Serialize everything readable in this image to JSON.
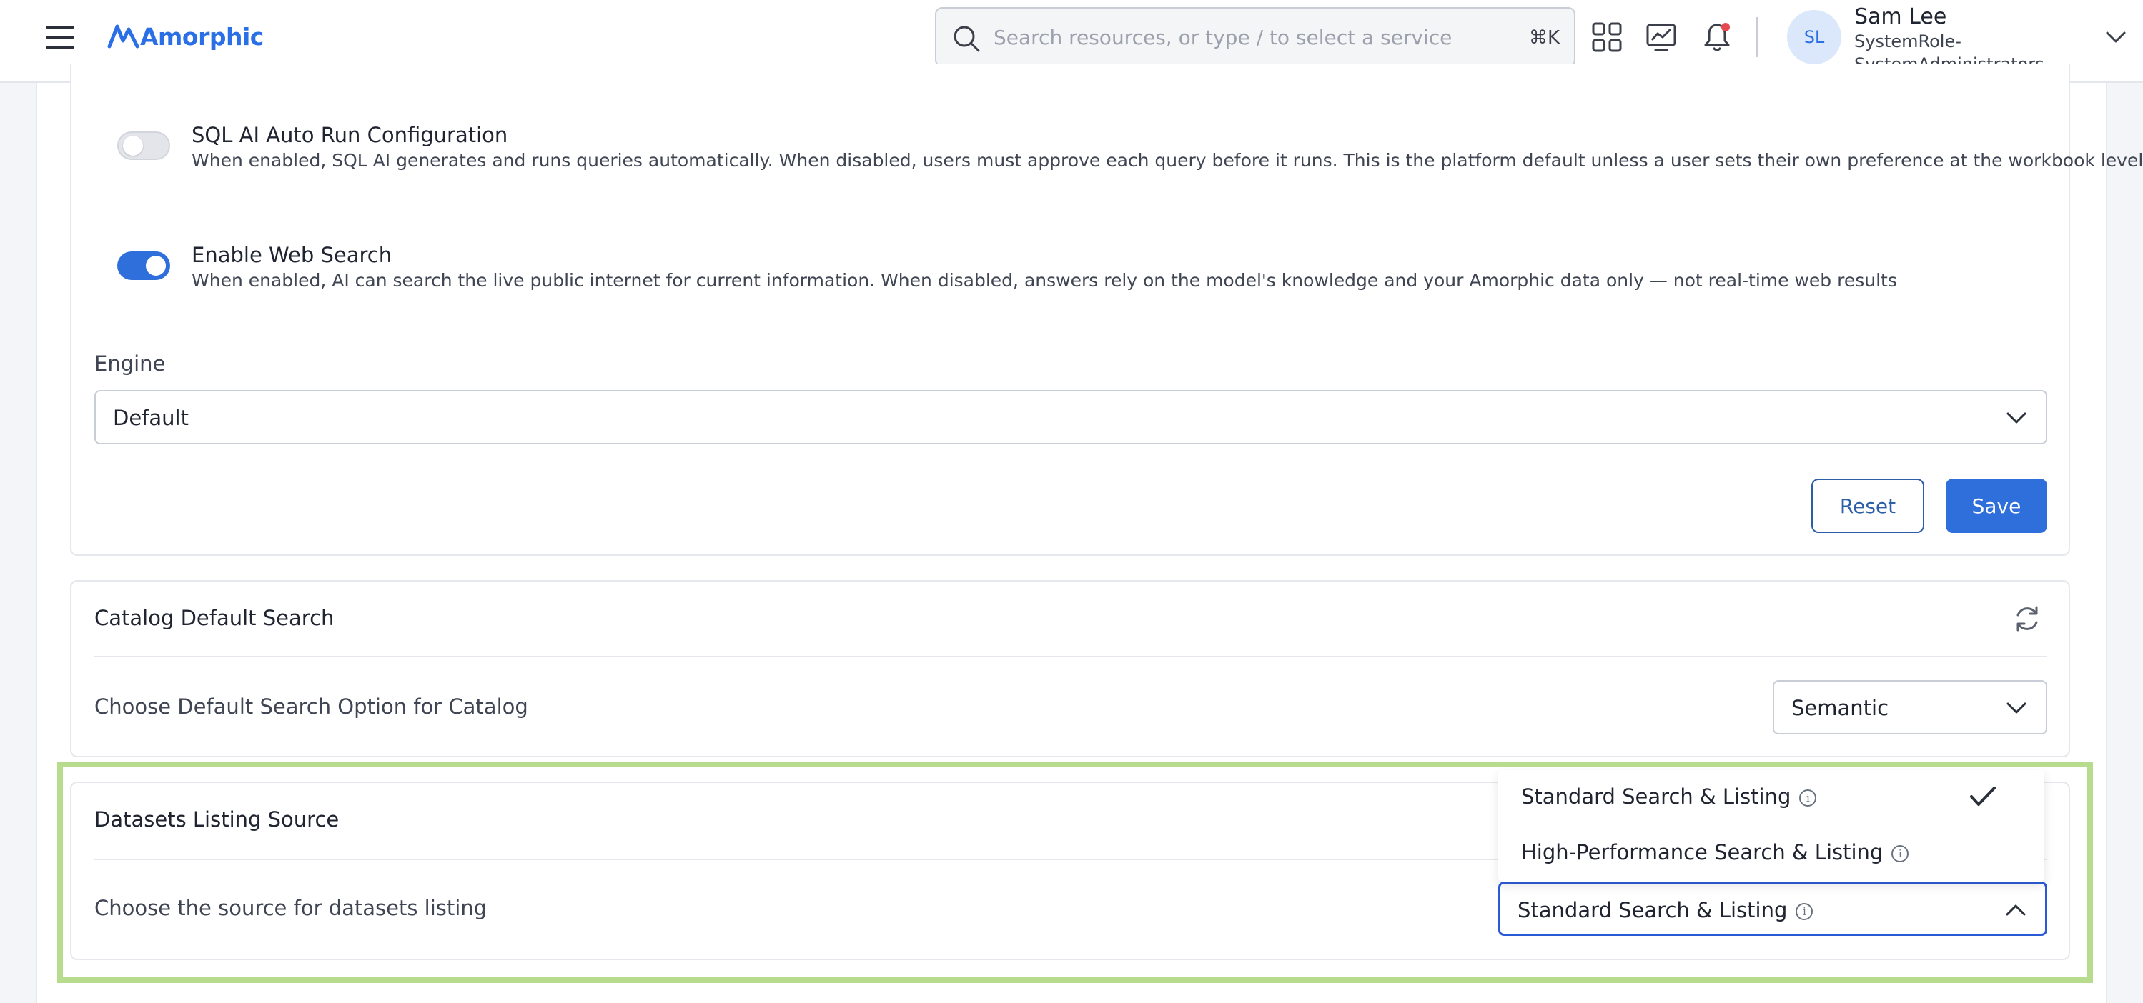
{
  "header": {
    "logo_text": "Amorphic",
    "search_placeholder": "Search resources, or type / to select a service",
    "search_shortcut": "⌘K",
    "user": {
      "initials": "SL",
      "name": "Sam Lee",
      "role": "SystemRole-SystemAdministrators"
    },
    "icons": [
      "menu-icon",
      "search-icon",
      "apps-grid-icon",
      "monitoring-chart-icon",
      "notification-bell-icon",
      "chevron-down-icon"
    ],
    "notification_dot_color": "#e5484d"
  },
  "ai_settings": {
    "sql_auto_run": {
      "title": "SQL AI Auto Run Configuration",
      "description": "When enabled, SQL AI generates and runs queries automatically. When disabled, users must approve each query before it runs. This is the platform default unless a user sets their own preference at the workbook level.",
      "enabled": false
    },
    "web_search": {
      "title": "Enable Web Search",
      "description": "When enabled, AI can search the live public internet for current information. When disabled, answers rely on the model's knowledge and your Amorphic data only — not real-time web results",
      "enabled": true
    },
    "engine": {
      "label": "Engine",
      "value": "Default"
    },
    "reset_label": "Reset",
    "save_label": "Save"
  },
  "catalog_search": {
    "title": "Catalog Default Search",
    "option_label": "Choose Default Search Option for Catalog",
    "value": "Semantic"
  },
  "datasets_listing": {
    "title": "Datasets Listing Source",
    "option_label": "Choose the source for datasets listing",
    "value": "Standard Search & Listing",
    "options": [
      {
        "label": "Standard Search & Listing",
        "selected": true
      },
      {
        "label": "High-Performance Search & Listing",
        "selected": false
      }
    ]
  },
  "colors": {
    "accent": "#2f6fdc",
    "highlight_border": "#b8dc8e",
    "focus_border": "#2a5bd7"
  }
}
